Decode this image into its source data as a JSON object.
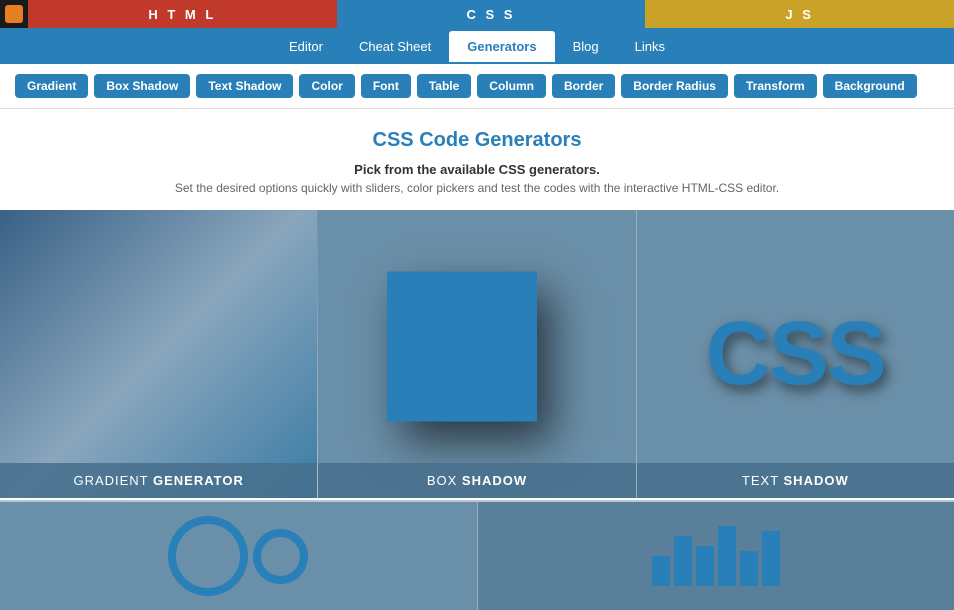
{
  "topbar": {
    "html_label": "H T M L",
    "css_label": "C S S",
    "js_label": "J S",
    "logo_text": ""
  },
  "nav": {
    "items": [
      {
        "label": "Editor",
        "active": false
      },
      {
        "label": "Cheat Sheet",
        "active": false
      },
      {
        "label": "Generators",
        "active": true
      },
      {
        "label": "Blog",
        "active": false
      },
      {
        "label": "Links",
        "active": false
      }
    ]
  },
  "toolbar": {
    "buttons": [
      "Gradient",
      "Box Shadow",
      "Text Shadow",
      "Color",
      "Font",
      "Table",
      "Column",
      "Border",
      "Border Radius",
      "Transform",
      "Background"
    ]
  },
  "heading": {
    "title": "CSS Code Generators",
    "bold_desc": "Pick from the available CSS generators.",
    "light_desc": "Set the desired options quickly with sliders, color pickers and test the codes with the interactive HTML-CSS editor."
  },
  "cards": {
    "row1": [
      {
        "id": "gradient",
        "label_light": "GRADIENT ",
        "label_bold": "GENERATOR"
      },
      {
        "id": "boxshadow",
        "label_light": "BOX ",
        "label_bold": "SHADOW"
      },
      {
        "id": "textshadow",
        "label_light": "TEXT ",
        "label_bold": "SHADOW",
        "demo_text": "CSS"
      }
    ]
  },
  "colors": {
    "accent_blue": "#2980b9",
    "nav_bg": "#2980b9",
    "html_red": "#c0392b",
    "js_gold": "#c9a227"
  }
}
